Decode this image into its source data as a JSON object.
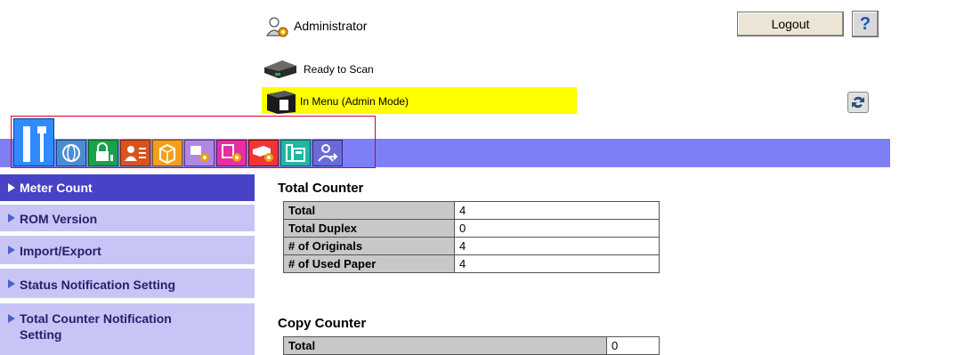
{
  "header": {
    "user_label": "Administrator",
    "logout_label": "Logout",
    "help_label": "?"
  },
  "status": {
    "scan_text": "Ready to Scan",
    "device_text": "In Menu (Admin Mode)"
  },
  "icons": {
    "refresh": "refresh-icon",
    "tabs": [
      "maintenance-icon",
      "network-icon",
      "security-icon",
      "user-auth-icon",
      "box-icon",
      "print-settings-icon",
      "store-address-icon",
      "scan-settings-icon",
      "fax-icon",
      "logout-user-icon"
    ]
  },
  "colors": {
    "tab_bar": "#7f7ff5",
    "sidebar_active": "#4842c7",
    "sidebar_item": "#c8c4f6",
    "status_highlight": "#ffff00",
    "icon_box_border": "#d7002d"
  },
  "sidebar": {
    "items": [
      {
        "label": "Meter Count",
        "active": true
      },
      {
        "label": "ROM Version"
      },
      {
        "label": "Import/Export"
      },
      {
        "label": "Status Notification Setting"
      },
      {
        "label": "Total Counter Notification Setting"
      }
    ]
  },
  "main": {
    "total_counter": {
      "title": "Total Counter",
      "rows": [
        {
          "label": "Total",
          "value": "4"
        },
        {
          "label": "Total Duplex",
          "value": "0"
        },
        {
          "label": "# of Originals",
          "value": "4"
        },
        {
          "label": "# of Used Paper",
          "value": "4"
        }
      ]
    },
    "copy_counter": {
      "title": "Copy Counter",
      "rows": [
        {
          "label": "Total",
          "value": "0"
        }
      ]
    }
  }
}
